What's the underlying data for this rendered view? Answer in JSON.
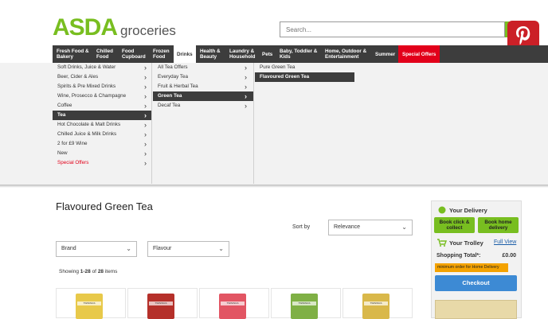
{
  "header": {
    "logo_brand": "ASDA",
    "logo_sub": "groceries",
    "search_placeholder": "Search..."
  },
  "nav": {
    "items": [
      {
        "label": "Fresh Food &\nBakery"
      },
      {
        "label": "Chilled\nFood"
      },
      {
        "label": "Food\nCupboard"
      },
      {
        "label": "Frozen\nFood"
      },
      {
        "label": "Drinks"
      },
      {
        "label": "Health &\nBeauty"
      },
      {
        "label": "Laundry &\nHousehold"
      },
      {
        "label": "Pets"
      },
      {
        "label": "Baby, Toddler &\nKids"
      },
      {
        "label": "Home, Outdoor &\nEntertainment"
      },
      {
        "label": "Summer"
      },
      {
        "label": "Special Offers"
      }
    ]
  },
  "menu": {
    "col1": [
      "Soft Drinks, Juice & Water",
      "Beer, Cider & Ales",
      "Spirits & Pre Mixed Drinks",
      "Wine, Prosecco & Champagne",
      "Coffee",
      "Tea",
      "Hot Chocolate & Malt Drinks",
      "Chilled Juice & Milk Drinks",
      "2 for £9 Wine",
      "New",
      "Special Offers"
    ],
    "col2": [
      "All Tea Offers",
      "Everyday Tea",
      "Fruit & Herbal Tea",
      "Green Tea",
      "Decaf Tea"
    ],
    "col3": [
      "Pure Green Tea",
      "Flavoured Green Tea"
    ]
  },
  "main": {
    "title": "Flavoured Green Tea",
    "sort_label": "Sort by",
    "sort_value": "Relevance",
    "filter_brand": "Brand",
    "filter_flavour": "Flavour",
    "showing_prefix": "Showing ",
    "showing_range": "1-28",
    "showing_mid": " of ",
    "showing_total": "28",
    "showing_suffix": " items",
    "product_brand": "TWININGS"
  },
  "sidebar": {
    "delivery_title": "Your Delivery",
    "click_collect": "Book click &\ncollect",
    "home_delivery": "Book home\ndelivery",
    "trolley_title": "Your Trolley",
    "full_view": "Full View",
    "total_label": "Shopping Total*:",
    "total_value": "£0.00",
    "min_order": "minimum order for Home Delivery",
    "checkout": "Checkout"
  },
  "colors": {
    "brand_green": "#78be20",
    "nav_dark": "#3d3d3d",
    "special_red": "#e2001a",
    "checkout_blue": "#3d8ad4",
    "pinterest": "#cb2027"
  }
}
